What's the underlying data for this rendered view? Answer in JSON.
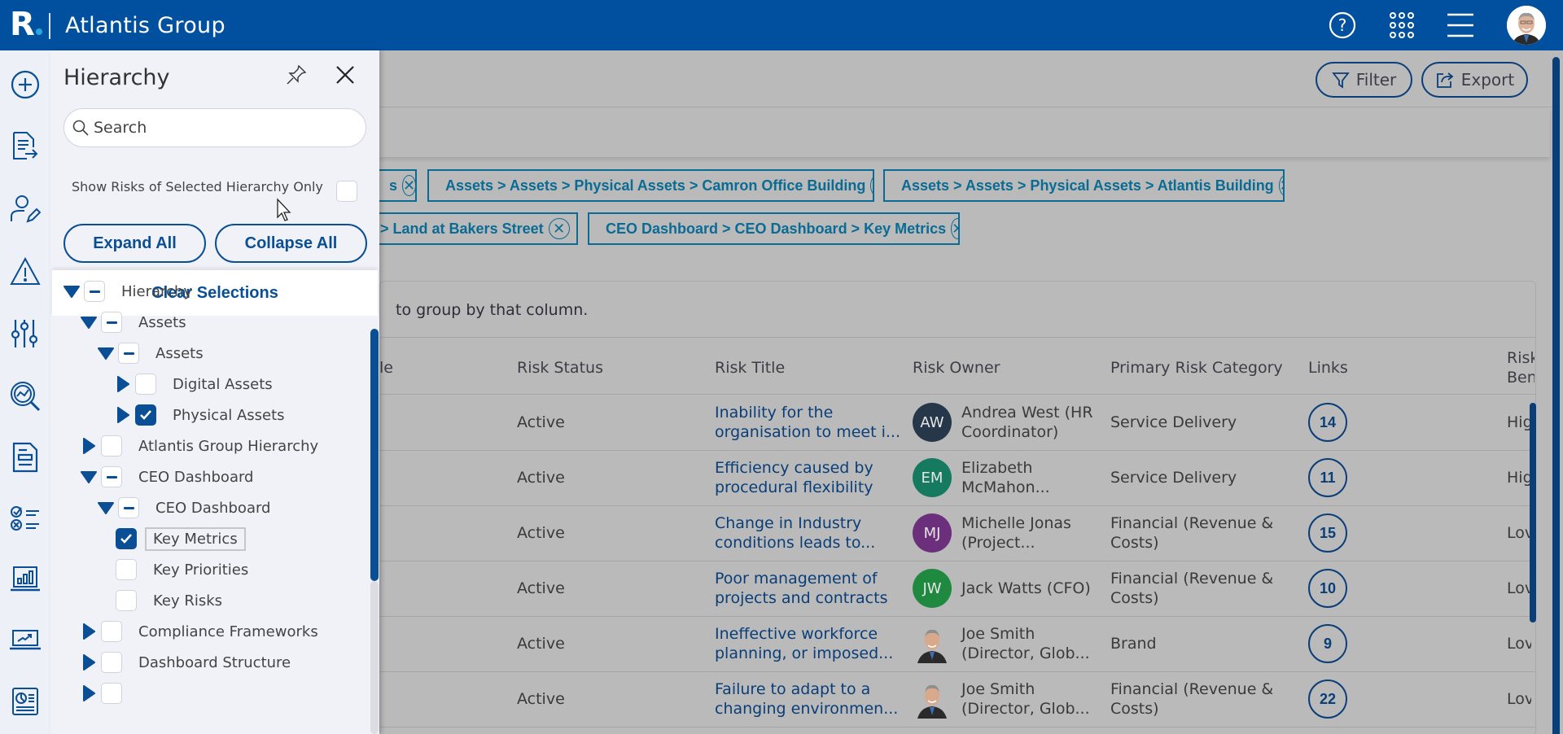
{
  "app": {
    "title": "Atlantis Group",
    "logo_letter": "R",
    "topbar_icons": [
      "help-icon",
      "apps-grid-icon",
      "hamburger-menu-icon",
      "user-avatar"
    ]
  },
  "colors": {
    "brand": "#0050a0",
    "accent": "#0a4f95",
    "chip": "#0a6b94",
    "overlay": "#bababa"
  },
  "rail": {
    "icons": [
      "add-icon",
      "document-export-icon",
      "user-edit-icon",
      "warning-icon",
      "sliders-icon",
      "analytics-search-icon",
      "document-icon",
      "checklist-icon",
      "laptop-chart-icon",
      "trend-icon",
      "report-icon"
    ]
  },
  "page": {
    "filter_label": "Filter",
    "export_label": "Export",
    "group_hint": "to group by that column.",
    "chips": [
      {
        "label": "s"
      },
      {
        "label": "Assets > Assets > Physical Assets > Camron Office Building"
      },
      {
        "label": "Assets > Assets > Physical Assets > Atlantis Building"
      },
      {
        "label": "s > Land at Bakers Street"
      },
      {
        "label": "CEO Dashboard > CEO Dashboard > Key Metrics"
      }
    ],
    "table": {
      "columns": [
        "le",
        "Risk Status",
        "Risk Title",
        "Risk Owner",
        "Primary Risk Category",
        "Links",
        "Risk Benc"
      ],
      "rows": [
        {
          "status": "Active",
          "title_l1": "Inability for the",
          "title_l2": "organisation to meet i...",
          "owner_initials": "AW",
          "owner_color": "#27374a",
          "owner_l1": "Andrea West (HR",
          "owner_l2": "Coordinator)",
          "category_l1": "Service Delivery",
          "category_l2": "",
          "links": "14",
          "bench": "Hig"
        },
        {
          "status": "Active",
          "title_l1": "Efficiency caused by",
          "title_l2": "procedural flexibility",
          "owner_initials": "EM",
          "owner_color": "#167a60",
          "owner_l1": "Elizabeth",
          "owner_l2": "McMahon...",
          "category_l1": "Service Delivery",
          "category_l2": "",
          "links": "11",
          "bench": "Hig"
        },
        {
          "status": "Active",
          "title_l1": "Change in Industry",
          "title_l2": "conditions leads to...",
          "owner_initials": "MJ",
          "owner_color": "#6b2f7c",
          "owner_l1": "Michelle Jonas",
          "owner_l2": "(Project...",
          "category_l1": "Financial (Revenue &",
          "category_l2": "Costs)",
          "links": "15",
          "bench": "Lov"
        },
        {
          "status": "Active",
          "title_l1": "Poor management of",
          "title_l2": "projects and contracts",
          "owner_initials": "JW",
          "owner_color": "#1f8a3f",
          "owner_l1": "Jack Watts (CFO)",
          "owner_l2": "",
          "category_l1": "Financial (Revenue &",
          "category_l2": "Costs)",
          "links": "10",
          "bench": "Lov"
        },
        {
          "status": "Active",
          "title_l1": "Ineffective workforce",
          "title_l2": "planning, or imposed...",
          "owner_initials": "photo",
          "owner_color": "",
          "owner_l1": "Joe Smith",
          "owner_l2": "(Director, Glob...",
          "category_l1": "Brand",
          "category_l2": "",
          "links": "9",
          "bench": "Lov"
        },
        {
          "status": "Active",
          "title_l1": "Failure to adapt to a",
          "title_l2": "changing environmen...",
          "owner_initials": "photo",
          "owner_color": "",
          "owner_l1": "Joe Smith",
          "owner_l2": "(Director, Glob...",
          "category_l1": "Financial (Revenue &",
          "category_l2": "Costs)",
          "links": "22",
          "bench": "Lov"
        }
      ]
    }
  },
  "panel": {
    "title": "Hierarchy",
    "search_placeholder": "Search",
    "show_risks_label": "Show Risks of Selected Hierarchy Only",
    "show_risks_checked": false,
    "expand_all": "Expand All",
    "collapse_all": "Collapse All",
    "clear_selections": "Clear Selections",
    "tree": [
      {
        "label": "Hierarchy",
        "level": 0,
        "toggle": "expanded",
        "state": "partial"
      },
      {
        "label": "Assets",
        "level": 1,
        "toggle": "expanded",
        "state": "partial"
      },
      {
        "label": "Assets",
        "level": 2,
        "toggle": "expanded",
        "state": "partial"
      },
      {
        "label": "Digital Assets",
        "level": 3,
        "toggle": "collapsed",
        "state": "unchecked"
      },
      {
        "label": "Physical Assets",
        "level": 3,
        "toggle": "collapsed",
        "state": "checked"
      },
      {
        "label": "Atlantis Group Hierarchy",
        "level": 1,
        "toggle": "collapsed",
        "state": "unchecked"
      },
      {
        "label": "CEO Dashboard",
        "level": 1,
        "toggle": "expanded",
        "state": "partial"
      },
      {
        "label": "CEO Dashboard",
        "level": 2,
        "toggle": "expanded",
        "state": "partial"
      },
      {
        "label": "Key Metrics",
        "level": 3,
        "toggle": "none",
        "state": "checked",
        "focused": true
      },
      {
        "label": "Key Priorities",
        "level": 3,
        "toggle": "none",
        "state": "unchecked"
      },
      {
        "label": "Key Risks",
        "level": 3,
        "toggle": "none",
        "state": "unchecked"
      },
      {
        "label": "Compliance Frameworks",
        "level": 1,
        "toggle": "collapsed",
        "state": "unchecked"
      },
      {
        "label": "Dashboard Structure",
        "level": 1,
        "toggle": "collapsed",
        "state": "unchecked"
      },
      {
        "label": "",
        "level": 1,
        "toggle": "collapsed",
        "state": "unchecked"
      }
    ]
  }
}
